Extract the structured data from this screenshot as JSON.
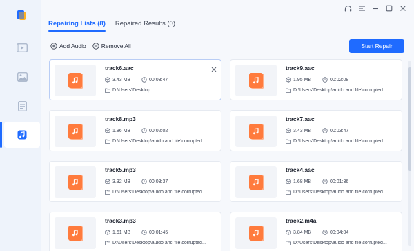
{
  "window": {
    "controls": [
      "headset-icon",
      "menu-icon",
      "minimize-icon",
      "maximize-icon",
      "close-icon"
    ]
  },
  "sidebar": {
    "items": [
      {
        "id": "video",
        "icon": "video-icon"
      },
      {
        "id": "photo",
        "icon": "photo-icon"
      },
      {
        "id": "document",
        "icon": "document-icon"
      },
      {
        "id": "audio",
        "icon": "music-icon",
        "active": true
      }
    ]
  },
  "tabs": [
    {
      "label": "Repairing Lists (8)",
      "active": true
    },
    {
      "label": "Repaired Results (0)",
      "active": false
    }
  ],
  "toolbar": {
    "add_label": "Add Audio",
    "remove_label": "Remove All",
    "start_label": "Start Repair"
  },
  "colors": {
    "accent": "#1f6bff",
    "music_tile": "#ff7b3d"
  },
  "files": [
    {
      "name": "track6.aac",
      "size": "3.43 MB",
      "duration": "00:03:47",
      "path": "D:\\Users\\Desktop",
      "selected": true
    },
    {
      "name": "track9.aac",
      "size": "1.95 MB",
      "duration": "00:02:08",
      "path": "D:\\Users\\Desktop\\auido and file\\corrupted..."
    },
    {
      "name": "track8.mp3",
      "size": "1.86 MB",
      "duration": "00:02:02",
      "path": "D:\\Users\\Desktop\\auido and file\\corrupted..."
    },
    {
      "name": "track7.aac",
      "size": "3.43 MB",
      "duration": "00:03:47",
      "path": "D:\\Users\\Desktop\\auido and file\\corrupted..."
    },
    {
      "name": "track5.mp3",
      "size": "3.32 MB",
      "duration": "00:03:37",
      "path": "D:\\Users\\Desktop\\auido and file\\corrupted..."
    },
    {
      "name": "track4.aac",
      "size": "1.68 MB",
      "duration": "00:01:36",
      "path": "D:\\Users\\Desktop\\auido and file\\corrupted..."
    },
    {
      "name": "track3.mp3",
      "size": "1.61 MB",
      "duration": "00:01:45",
      "path": "D:\\Users\\Desktop\\auido and file\\corrupted..."
    },
    {
      "name": "track2.m4a",
      "size": "3.84 MB",
      "duration": "00:04:04",
      "path": "D:\\Users\\Desktop\\auido and file\\corrupted..."
    }
  ]
}
